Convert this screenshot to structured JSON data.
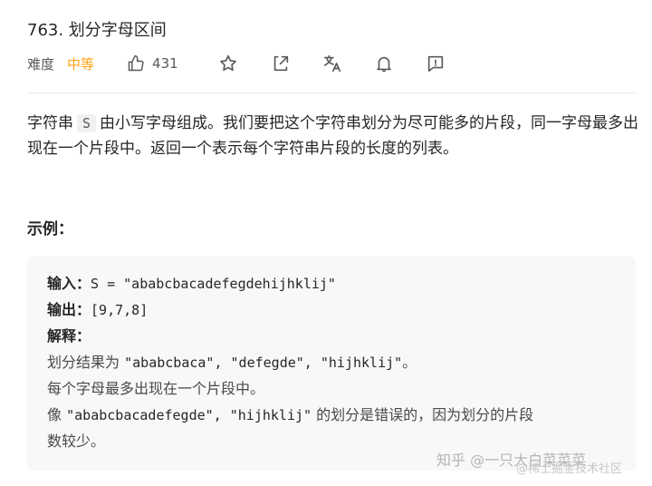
{
  "problem": {
    "title": "763. 划分字母区间",
    "difficulty_label": "难度",
    "difficulty": "中等",
    "likes": "431"
  },
  "toolbar": {
    "icons": [
      "thumbs-up-icon",
      "star-icon",
      "share-icon",
      "translate-icon",
      "bell-icon",
      "feedback-icon"
    ]
  },
  "description": {
    "text_before": "字符串",
    "var": "S",
    "text_after": "由小写字母组成。我们要把这个字符串划分为尽可能多的片段，同一字母最多出现在一个片段中。返回一个表示每个字符串片段的长度的列表。"
  },
  "example": {
    "heading": "示例：",
    "input_label": "输入：",
    "input_value": "S = \"ababcbacadefegdehijhklij\"",
    "output_label": "输出：",
    "output_value": "[9,7,8]",
    "explain_label": "解释：",
    "explain_1_prefix": "划分结果为",
    "explain_1_code": "\"ababcbaca\", \"defegde\", \"hijhklij\"",
    "explain_1_suffix": "。",
    "explain_2": "每个字母最多出现在一个片段中。",
    "explain_3_prefix": "像",
    "explain_3_code": "\"ababcbacadefegde\", \"hijhklij\"",
    "explain_3_suffix": "的划分是错误的，因为划分的片段",
    "explain_4": "数较少。"
  },
  "watermark": {
    "main": "知乎 @一只大白菜菜菜",
    "sub": "@稀土掘金技术社区"
  },
  "colors": {
    "accent": "#ffa116",
    "text": "#262626",
    "code_bg": "#f7f8fa"
  }
}
